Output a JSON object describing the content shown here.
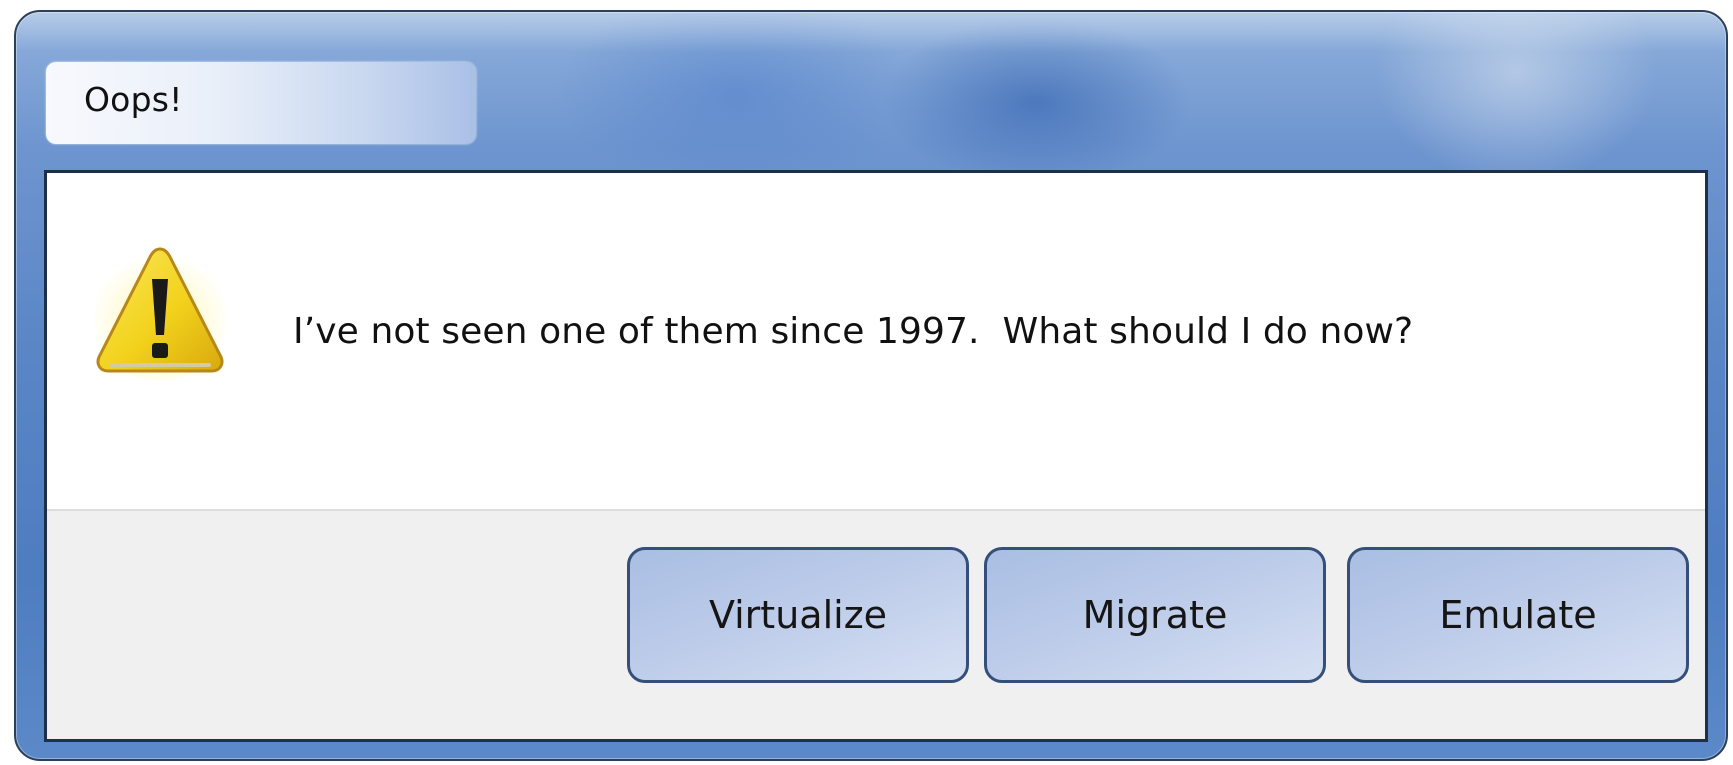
{
  "dialog": {
    "title": "Oops!",
    "message": "I’ve not seen one of them since 1997.  What should I do now?",
    "icon": "warning-icon",
    "buttons": [
      {
        "label": "Virtualize"
      },
      {
        "label": "Migrate"
      },
      {
        "label": "Emulate"
      }
    ]
  },
  "colors": {
    "frame": "#5a86c6",
    "frame_border": "#2a3f5a",
    "content_border": "#1d2f49",
    "button_border": "#34507a",
    "button_fill": "#bccbe9",
    "button_strip": "#f0f0f0",
    "warning_yellow": "#f2d21c"
  }
}
